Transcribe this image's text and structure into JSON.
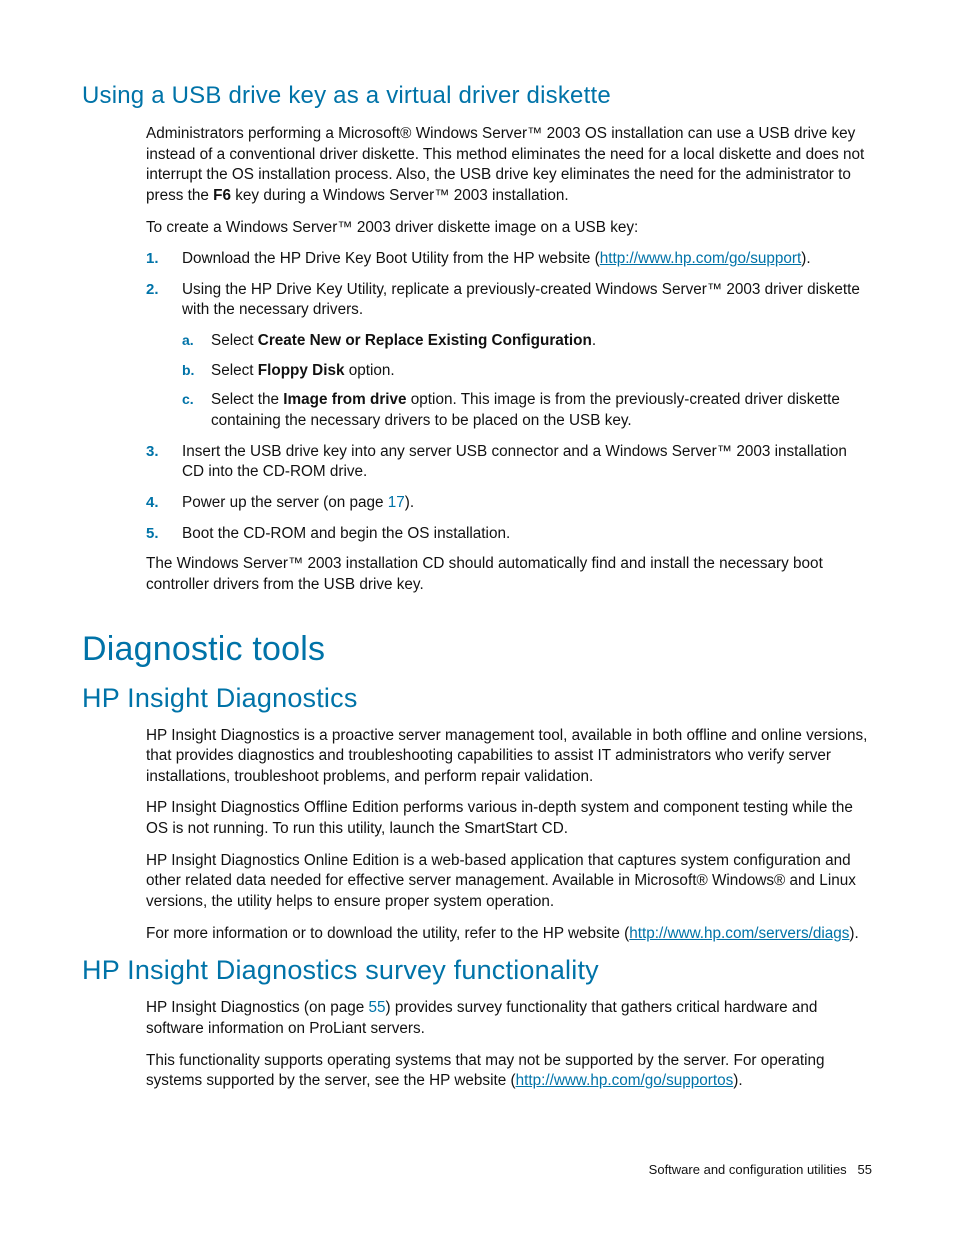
{
  "sec1": {
    "heading": "Using a USB drive key as a virtual driver diskette",
    "intro_1a": "Administrators performing a Microsoft® Windows Server™ 2003 OS installation can use a USB drive key instead of a conventional driver diskette. This method eliminates the need for a local diskette and does not interrupt the OS installation process. Also, the USB drive key eliminates the need for the administrator to press the ",
    "intro_1_key": "F6",
    "intro_1b": " key during a Windows Server™ 2003 installation.",
    "intro_2": "To create a Windows Server™ 2003 driver diskette image on a USB key:",
    "steps": {
      "s1_a": "Download the HP Drive Key Boot Utility from the HP website (",
      "s1_link": "http://www.hp.com/go/support",
      "s1_b": ").",
      "s2": "Using the HP Drive Key Utility, replicate a previously-created Windows Server™ 2003 driver diskette with the necessary drivers.",
      "s2a_a": "Select ",
      "s2a_bold": "Create New or Replace Existing Configuration",
      "s2a_b": ".",
      "s2b_a": "Select ",
      "s2b_bold": "Floppy Disk",
      "s2b_b": " option.",
      "s2c_a": "Select the ",
      "s2c_bold": "Image from drive",
      "s2c_b": " option. This image is from the previously-created driver diskette containing the necessary drivers to be placed on the USB key.",
      "s3": "Insert the USB drive key into any server USB connector and a Windows Server™ 2003 installation CD into the CD-ROM drive.",
      "s4_a": "Power up the server (on page ",
      "s4_page": "17",
      "s4_b": ").",
      "s5": "Boot the CD-ROM and begin the OS installation."
    },
    "outro": "The Windows Server™ 2003 installation CD should automatically find and install the necessary boot controller drivers from the USB drive key."
  },
  "sec2": {
    "heading": "Diagnostic tools",
    "sub1": {
      "heading": "HP Insight Diagnostics",
      "p1": "HP Insight Diagnostics is a proactive server management tool, available in both offline and online versions, that provides diagnostics and troubleshooting capabilities to assist IT administrators who verify server installations, troubleshoot problems, and perform repair validation.",
      "p2": "HP Insight Diagnostics Offline Edition performs various in-depth system and component testing while the OS is not running. To run this utility, launch the SmartStart CD.",
      "p3": "HP Insight Diagnostics Online Edition is a web-based application that captures system configuration and other related data needed for effective server management. Available in Microsoft® Windows® and Linux versions, the utility helps to ensure proper system operation.",
      "p4_a": "For more information or to download the utility, refer to the HP website (",
      "p4_link": "http://www.hp.com/servers/diags",
      "p4_b": ")."
    },
    "sub2": {
      "heading": "HP Insight Diagnostics survey functionality",
      "p1_a": "HP Insight Diagnostics (on page ",
      "p1_page": "55",
      "p1_b": ") provides survey functionality that gathers critical hardware and software information on ProLiant servers.",
      "p2_a": "This functionality supports operating systems that may not be supported by the server. For operating systems supported by the server, see the HP website (",
      "p2_link": "http://www.hp.com/go/supportos",
      "p2_b": ")."
    }
  },
  "footer": {
    "label": "Software and configuration utilities",
    "pagenum": "55"
  },
  "markers": {
    "n1": "1.",
    "n2": "2.",
    "n3": "3.",
    "n4": "4.",
    "n5": "5.",
    "la": "a.",
    "lb": "b.",
    "lc": "c."
  }
}
